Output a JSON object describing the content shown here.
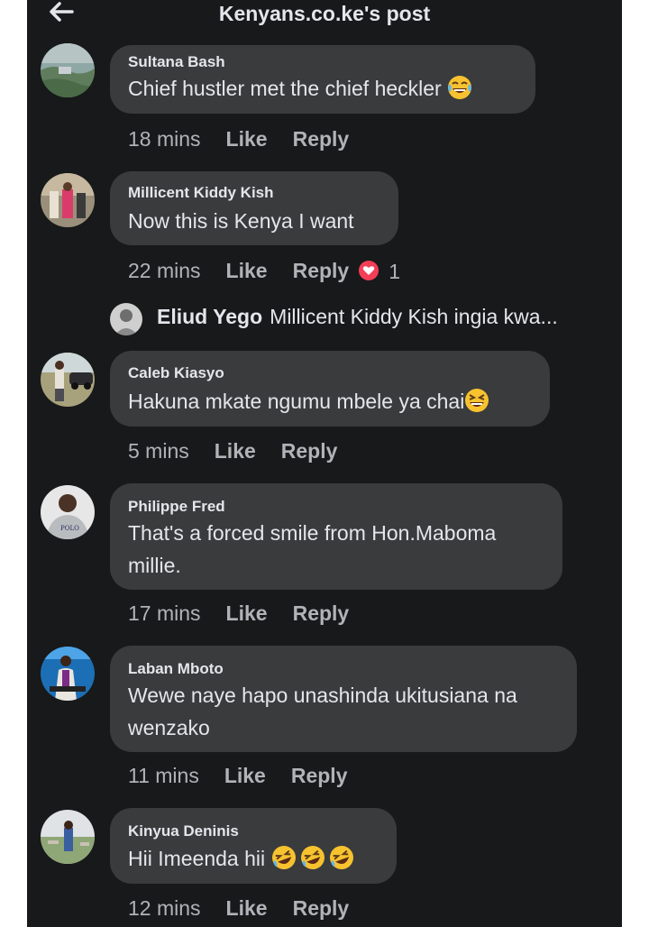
{
  "header": {
    "title": "Kenyans.co.ke's post",
    "back_icon": "arrow-left-icon"
  },
  "actions": {
    "like": "Like",
    "reply": "Reply"
  },
  "comments": [
    {
      "name": "Sultana Bash",
      "line1": "Chief hustler met the chief heckler",
      "line2": "",
      "emoji": "face-with-tears-of-joy",
      "time": "18 mins"
    },
    {
      "name": "Millicent Kiddy Kish",
      "line1": "Now this is Kenya I want",
      "line2": "",
      "time": "22 mins",
      "reaction_count": "1",
      "reaction_icon": "heart-reaction-icon"
    },
    {
      "name": "Caleb Kiasyo",
      "line1": "Hakuna mkate ngumu mbele ya chai",
      "line2": "",
      "emoji": "grinning-squinting-face",
      "time": "5 mins"
    },
    {
      "name": "Philippe Fred",
      "line1": "That's a forced smile from Hon.Maboma",
      "line2": "millie.",
      "time": "17 mins"
    },
    {
      "name": "Laban Mboto",
      "line1": "Wewe naye hapo unashinda ukitusiana na",
      "line2": "wenzako",
      "time": "11 mins"
    },
    {
      "name": "Kinyua Deninis",
      "line1": "Hii Imeenda hii",
      "line2": "",
      "emoji": "rolling-on-the-floor-laughing x3",
      "time": "12 mins"
    }
  ],
  "reply_preview": {
    "name": "Eliud Yego",
    "text": "Millicent Kiddy Kish ingia kwa..."
  },
  "colors": {
    "background": "#18191a",
    "bubble": "#3a3b3c",
    "text": "#e4e6eb",
    "meta": "#b0b3b8",
    "heart": "#f33e58"
  }
}
